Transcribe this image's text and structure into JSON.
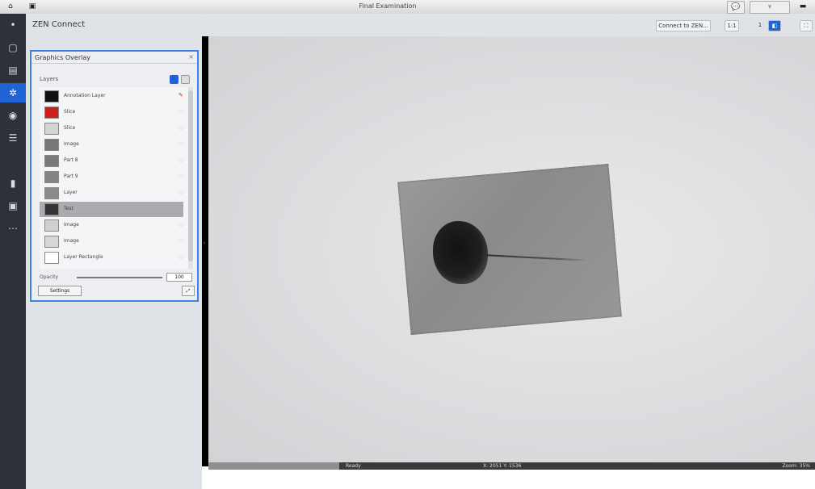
{
  "window": {
    "title": "Final Examination"
  },
  "app": {
    "title": "ZEN Connect",
    "header_buttons": [
      "Connect to ZEN...",
      "1:1",
      "1"
    ]
  },
  "leftbar": {
    "icons": [
      "menu-icon",
      "document-icon",
      "folder-icon",
      "analysis-icon",
      "camera-icon",
      "sliders-icon",
      "measure-icon",
      "export-icon",
      "more-icon"
    ]
  },
  "toolwindow": {
    "title": "Graphics Overlay",
    "list_label": "Layers",
    "items": [
      {
        "label": "Annotation Layer",
        "color": "#111111"
      },
      {
        "label": "Slice",
        "color": "#d31c1c"
      },
      {
        "label": "Slice",
        "color": "#d5d5d5"
      },
      {
        "label": "Image",
        "color": "#777777"
      },
      {
        "label": "Part 8",
        "color": "#7a7a7a"
      },
      {
        "label": "Part 9",
        "color": "#858585"
      },
      {
        "label": "Layer",
        "color": "#8a8a8a"
      },
      {
        "label": "Test",
        "color": "#333333"
      },
      {
        "label": "Image",
        "color": "#d0d0d0"
      },
      {
        "label": "Image",
        "color": "#d7d7d7"
      },
      {
        "label": "Layer Rectangle",
        "color": "#ffffff"
      }
    ],
    "selected_index": 7,
    "opacity_label": "Opacity",
    "opacity_value": "100",
    "footer_button": "Settings"
  },
  "statusbar": {
    "left": "Ready",
    "center": "X: 2051 Y: 1536",
    "right": "Zoom: 35%"
  }
}
